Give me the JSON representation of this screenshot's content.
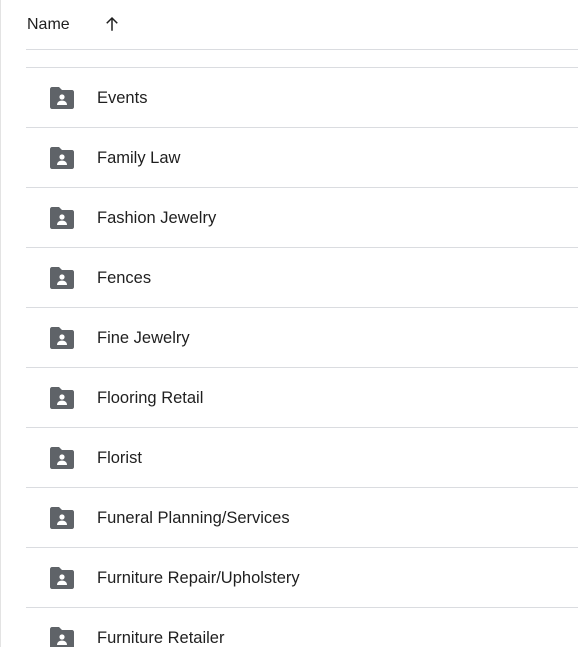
{
  "header": {
    "name_label": "Name",
    "sort_icon": "arrow-up-icon"
  },
  "folder_icon": "shared-folder-icon",
  "folders": [
    {
      "name": "Events"
    },
    {
      "name": "Family Law"
    },
    {
      "name": "Fashion Jewelry"
    },
    {
      "name": "Fences"
    },
    {
      "name": "Fine Jewelry"
    },
    {
      "name": "Flooring Retail"
    },
    {
      "name": "Florist"
    },
    {
      "name": "Funeral Planning/Services"
    },
    {
      "name": "Furniture Repair/Upholstery"
    },
    {
      "name": "Furniture Retailer"
    }
  ],
  "colors": {
    "icon": "#5f6368",
    "divider": "#dadce0",
    "text": "#1f1f1f"
  }
}
